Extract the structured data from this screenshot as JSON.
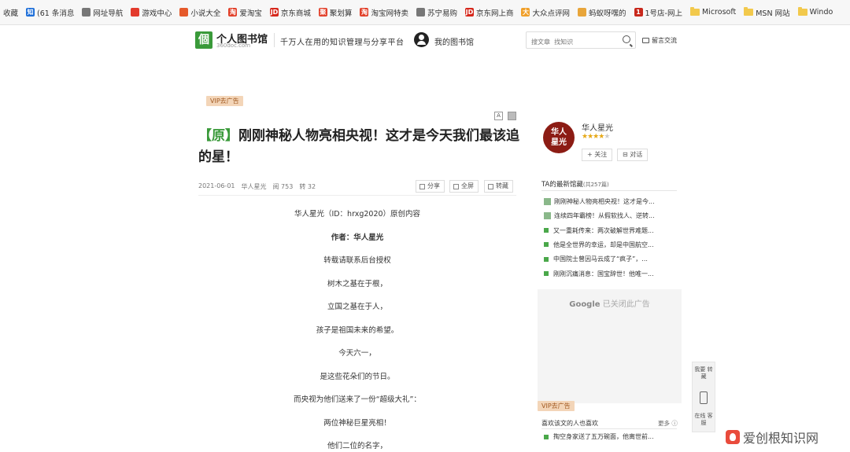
{
  "bookmarks": [
    {
      "label": "收藏",
      "icon": "none",
      "color": ""
    },
    {
      "label": "(61 条消息",
      "icon": "zhi-icon",
      "badge": "知",
      "color": "#1e6fd9"
    },
    {
      "label": "网址导航",
      "icon": "globe-icon",
      "badge": "",
      "color": "#777777"
    },
    {
      "label": "游戏中心",
      "icon": "game-icon",
      "badge": "",
      "color": "#e33a2c"
    },
    {
      "label": "小说大全",
      "icon": "book-icon",
      "badge": "",
      "color": "#e55a2b"
    },
    {
      "label": "爱淘宝",
      "icon": "taobao-icon",
      "badge": "淘",
      "color": "#e2412b"
    },
    {
      "label": "京东商城",
      "icon": "jd-icon",
      "badge": "JD",
      "color": "#d6281c"
    },
    {
      "label": "聚划算",
      "icon": "juhuasuan-icon",
      "badge": "聚",
      "color": "#e2412b"
    },
    {
      "label": "淘宝网特卖",
      "icon": "taobao-icon",
      "badge": "淘",
      "color": "#e2412b"
    },
    {
      "label": "苏宁易购",
      "icon": "suning-icon",
      "badge": "",
      "color": "#777777"
    },
    {
      "label": "京东网上商",
      "icon": "jd-icon",
      "badge": "JD",
      "color": "#d6281c"
    },
    {
      "label": "大众点评网",
      "icon": "dianping-icon",
      "badge": "大",
      "color": "#f0a02b"
    },
    {
      "label": "蚂蚁呀嘿的",
      "icon": "ant-icon",
      "badge": "",
      "color": "#e8a53a"
    },
    {
      "label": "1号店-网上",
      "icon": "yhd-icon",
      "badge": "1",
      "color": "#c8281c"
    },
    {
      "label": "Microsoft",
      "icon": "folder-icon",
      "badge": "",
      "color": ""
    },
    {
      "label": "MSN 网站",
      "icon": "folder-icon",
      "badge": "",
      "color": ""
    },
    {
      "label": "Windo",
      "icon": "folder-icon",
      "badge": "",
      "color": ""
    }
  ],
  "header": {
    "logo_char": "個",
    "logo_title": "个人图书馆",
    "logo_sub": "360doc.com",
    "slogan": "千万人在用的知识管理与分享平台",
    "my_library": "我的图书馆",
    "search_placeholder": "搜文章  找知识",
    "message": "留言交流"
  },
  "article": {
    "vip_tag": "VIP去广告",
    "font_tool": "A",
    "title_prefix": "【原】",
    "title": "刚刚神秘人物亮相央视！这才是今天我们最该追的星！",
    "meta": {
      "date": "2021-06-01",
      "author": "华人星光",
      "reads": "阅 753",
      "shares": "转 32"
    },
    "actions": {
      "share": "分享",
      "fullscreen": "全屏",
      "save": "转藏"
    },
    "paragraphs": [
      {
        "text": "华人星光（ID：hrxg2020）原创内容",
        "bold": false
      },
      {
        "text": "作者：华人星光",
        "bold": true
      },
      {
        "text": "转载请联系后台授权",
        "bold": false
      },
      {
        "text": "树木之基在于根，",
        "bold": false
      },
      {
        "text": "立国之基在于人，",
        "bold": false
      },
      {
        "text": "孩子是祖国未来的希望。",
        "bold": false
      },
      {
        "text": "今天六一，",
        "bold": false
      },
      {
        "text": "是这些花朵们的节日。",
        "bold": false
      },
      {
        "text": "而央视为他们送来了一份“超级大礼”：",
        "bold": false
      },
      {
        "text": "两位神秘巨星亮相！",
        "bold": false
      },
      {
        "text": "他们二位的名字，",
        "bold": false
      }
    ]
  },
  "sidebar": {
    "seal_text": "华人星光",
    "author_name": "华人星光",
    "rating": {
      "filled": 4,
      "total": 5
    },
    "follow": "+ 关注",
    "chat": "对话",
    "latest_title": "TA的最新馆藏",
    "latest_count": "(共257篇)",
    "latest": [
      "刚刚神秘人物亮相央视！这才是今...",
      "连续四年霸榜！从假软找人、逆转...",
      "又一重耗传来：两次破解世界难题...",
      "他是全世界的幸运，却是中国航空...",
      "中国院士曾因马云成了“疯子”，...",
      "刚刚沉痛消息：国宝辞世！他唯一..."
    ],
    "ad_google": "Google",
    "ad_closed": "已关闭此广告",
    "vip_tag": "VIP去广告",
    "like_title": "喜欢该文的人也喜欢",
    "like_more": "更多",
    "like_items": [
      "掏空身家送了五万碗面，他离世前..."
    ]
  },
  "float_tool": {
    "top": "我要 转藏",
    "bottom": "在线 客服"
  },
  "watermark": "爱创根知识网"
}
